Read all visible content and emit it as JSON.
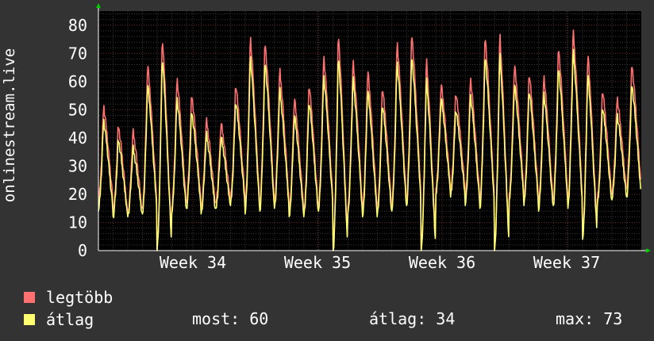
{
  "chart_data": {
    "type": "line",
    "ylabel": "onlinestream.live",
    "ylim": [
      0,
      85
    ],
    "yticks": [
      0,
      10,
      20,
      30,
      40,
      50,
      60,
      70,
      80
    ],
    "x_tick_labels": [
      "Week 34",
      "Week 35",
      "Week 36",
      "Week 37"
    ],
    "grid": true,
    "legend_placement": "bottom-left",
    "series": [
      {
        "name": "legtöbb",
        "color": "#ff7070",
        "daily_peaks": [
          52,
          45,
          43,
          67,
          77,
          62,
          56,
          47,
          46,
          60,
          77,
          75,
          65,
          55,
          60,
          70,
          78,
          68,
          65,
          59,
          75,
          78,
          69,
          60,
          57,
          62,
          77,
          78,
          67,
          64,
          63,
          73,
          79,
          71,
          58,
          55,
          67
        ],
        "daily_troughs": [
          17,
          13,
          13,
          15,
          0,
          15,
          17,
          15,
          17,
          18,
          15,
          16,
          17,
          14,
          13,
          16,
          0,
          15,
          14,
          14,
          16,
          18,
          0,
          22,
          21,
          18,
          17,
          0,
          20,
          18,
          16,
          18,
          17,
          5,
          18,
          20,
          22
        ]
      },
      {
        "name": "átlag",
        "color": "#ffff70",
        "daily_peaks": [
          47,
          40,
          37,
          60,
          70,
          55,
          50,
          42,
          41,
          54,
          70,
          68,
          58,
          49,
          54,
          63,
          70,
          62,
          58,
          53,
          68,
          70,
          62,
          55,
          51,
          56,
          70,
          71,
          60,
          58,
          57,
          66,
          72,
          64,
          52,
          49,
          60
        ],
        "daily_troughs": [
          14,
          12,
          12,
          13,
          0,
          13,
          15,
          13,
          15,
          16,
          13,
          14,
          15,
          12,
          12,
          14,
          0,
          13,
          12,
          12,
          14,
          16,
          0,
          20,
          19,
          16,
          15,
          0,
          18,
          16,
          14,
          16,
          15,
          4,
          16,
          18,
          19
        ]
      }
    ]
  },
  "legend": {
    "max_label": "legtöbb",
    "avg_label": "átlag",
    "max_color": "#ff7070",
    "avg_color": "#ffff70"
  },
  "stats": {
    "current": "most: 60",
    "average": "átlag: 34",
    "maximum": "max: 73"
  }
}
